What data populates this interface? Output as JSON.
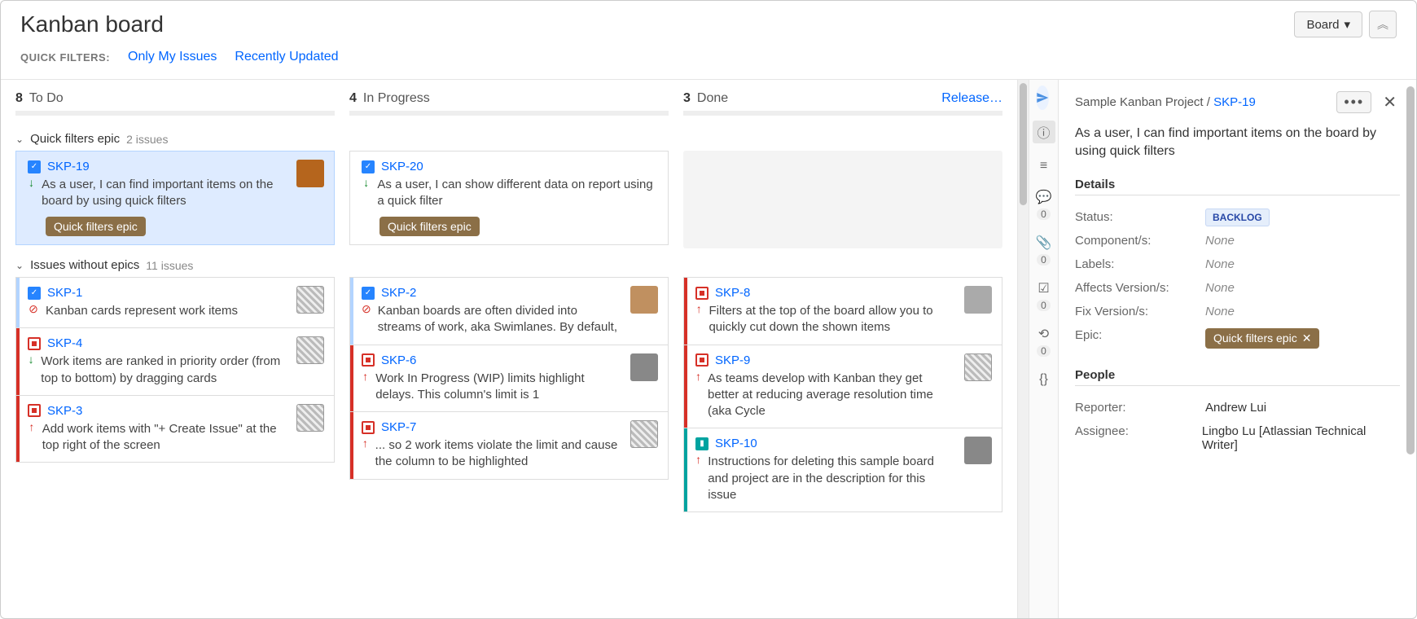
{
  "header": {
    "title": "Kanban board",
    "board_dropdown_label": "Board",
    "filters_label": "QUICK FILTERS:",
    "filter_links": [
      "Only My Issues",
      "Recently Updated"
    ]
  },
  "columns": [
    {
      "count": "8",
      "name": "To Do"
    },
    {
      "count": "4",
      "name": "In Progress"
    },
    {
      "count": "3",
      "name": "Done",
      "release_label": "Release…"
    }
  ],
  "swimlanes": [
    {
      "title": "Quick filters epic",
      "count_label": "2 issues",
      "cols": [
        [
          {
            "key": "SKP-19",
            "type": "task",
            "prio": "down",
            "summary": "As a user, I can find important items on the board by using quick filters",
            "epic": "Quick filters epic",
            "avatar": "person1",
            "selected": true,
            "edge": ""
          }
        ],
        [
          {
            "key": "SKP-20",
            "type": "task",
            "prio": "down",
            "summary": "As a user, I can show different data on report using a quick filter",
            "epic": "Quick filters epic",
            "avatar": "",
            "edge": ""
          }
        ],
        []
      ]
    },
    {
      "title": "Issues without epics",
      "count_label": "11 issues",
      "cols": [
        [
          {
            "key": "SKP-1",
            "type": "task",
            "prio": "block",
            "summary": "Kanban cards represent work items",
            "avatar": "hex",
            "edge": "blue"
          },
          {
            "key": "SKP-4",
            "type": "bug",
            "prio": "down",
            "summary": "Work items are ranked in priority order (from top to bottom) by dragging cards",
            "avatar": "hex",
            "edge": "red"
          },
          {
            "key": "SKP-3",
            "type": "bug",
            "prio": "up",
            "summary": "Add work items with \"+ Create Issue\" at the top right of the screen",
            "avatar": "hex",
            "edge": "red"
          }
        ],
        [
          {
            "key": "SKP-2",
            "type": "task",
            "prio": "block",
            "summary": "Kanban boards are often divided into streams of work, aka Swimlanes. By default,",
            "avatar": "person2",
            "edge": "blue"
          },
          {
            "key": "SKP-6",
            "type": "bug",
            "prio": "up",
            "summary": "Work In Progress (WIP) limits highlight delays. This column's limit is 1",
            "avatar": "person3",
            "edge": "red"
          },
          {
            "key": "SKP-7",
            "type": "bug",
            "prio": "up",
            "summary": "... so 2 work items violate the limit and cause the column to be highlighted",
            "avatar": "hex",
            "edge": "red"
          }
        ],
        [
          {
            "key": "SKP-8",
            "type": "bug",
            "prio": "up",
            "summary": "Filters at the top of the board allow you to quickly cut down the shown items",
            "avatar": "person4",
            "edge": "red"
          },
          {
            "key": "SKP-9",
            "type": "bug",
            "prio": "up",
            "summary": "As teams develop with Kanban they get better at reducing average resolution time (aka Cycle",
            "avatar": "hex",
            "edge": "red"
          },
          {
            "key": "SKP-10",
            "type": "story",
            "prio": "up",
            "summary": "Instructions for deleting this sample board and project are in the description for this issue",
            "avatar": "person3",
            "edge": "teal"
          }
        ]
      ]
    }
  ],
  "detail": {
    "project": "Sample Kanban Project",
    "sep": " / ",
    "key": "SKP-19",
    "summary": "As a user, I can find important items on the board by using quick filters",
    "sections": {
      "details_title": "Details",
      "people_title": "People"
    },
    "fields": {
      "status_label": "Status:",
      "status_value": "BACKLOG",
      "components_label": "Component/s:",
      "components_value": "None",
      "labels_label": "Labels:",
      "labels_value": "None",
      "affects_label": "Affects Version/s:",
      "affects_value": "None",
      "fix_label": "Fix Version/s:",
      "fix_value": "None",
      "epic_label": "Epic:",
      "epic_value": "Quick filters epic",
      "reporter_label": "Reporter:",
      "reporter_value": "Andrew Lui",
      "assignee_label": "Assignee:",
      "assignee_value": "Lingbo Lu [Atlassian Technical Writer]"
    }
  },
  "rail": {
    "badges": {
      "comments": "0",
      "attachments": "0",
      "subtasks": "0",
      "worklog": "0"
    }
  }
}
